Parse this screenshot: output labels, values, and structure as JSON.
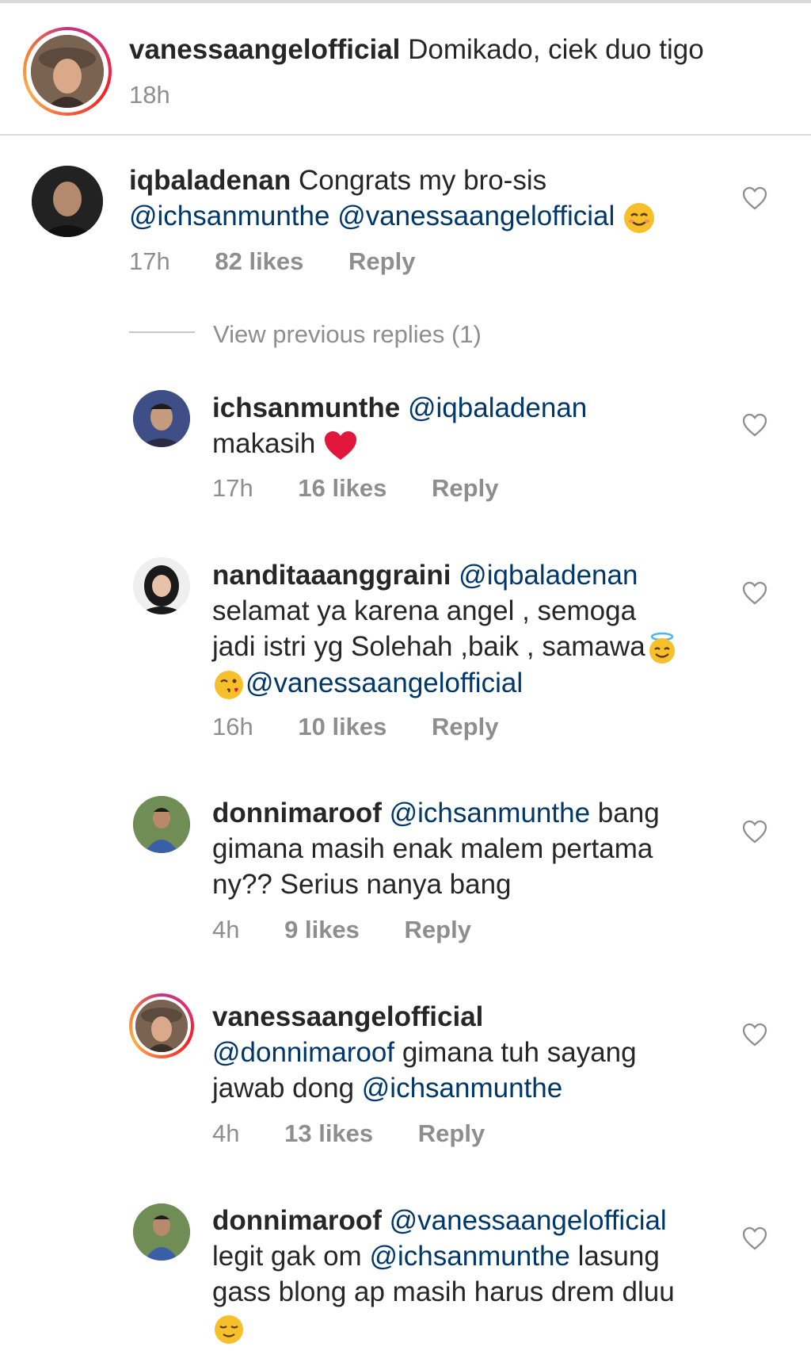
{
  "caption": {
    "username": "vanessaangelofficial",
    "text": "Domikado, ciek duo tigo",
    "time": "18h"
  },
  "view_previous_replies": "View previous replies (1)",
  "comments": [
    {
      "username": "iqbaladenan",
      "line1": "Congrats my bro-sis",
      "mention1": "@ichsanmunthe",
      "mention2": "@vanessaangelofficial",
      "time": "17h",
      "likes": "82 likes",
      "reply": "Reply"
    },
    {
      "username": "ichsanmunthe",
      "mention1": "@iqbaladenan",
      "line2": "makasih",
      "time": "17h",
      "likes": "16 likes",
      "reply": "Reply"
    },
    {
      "username": "nanditaaanggraini",
      "mention1": "@iqbaladenan",
      "line2": "selamat ya karena angel , semoga",
      "line3": "jadi istri yg Solehah ,baik , samawa",
      "mention2": "@vanessaangelofficial",
      "time": "16h",
      "likes": "10 likes",
      "reply": "Reply"
    },
    {
      "username": "donnimaroof",
      "mention1": "@ichsanmunthe",
      "word1": "bang",
      "line2": "gimana masih enak malem pertama",
      "line3": "ny?? Serius nanya bang",
      "time": "4h",
      "likes": "9 likes",
      "reply": "Reply"
    },
    {
      "username": "vanessaangelofficial",
      "mention1": "@donnimaroof",
      "line2": "gimana tuh sayang",
      "line3": "jawab dong",
      "mention2": "@ichsanmunthe",
      "time": "4h",
      "likes": "13 likes",
      "reply": "Reply"
    },
    {
      "username": "donnimaroof",
      "mention1": "@vanessaangelofficial",
      "line2a": "legit gak om",
      "mention2": "@ichsanmunthe",
      "line2b": "lasung",
      "line3": "gass blong ap masih harus drem dluu"
    }
  ],
  "icons": {
    "like": "heart-outline-icon"
  },
  "colors": {
    "mention": "#00376b",
    "meta": "#8e8e8e",
    "heart_red": "#e0163a"
  }
}
